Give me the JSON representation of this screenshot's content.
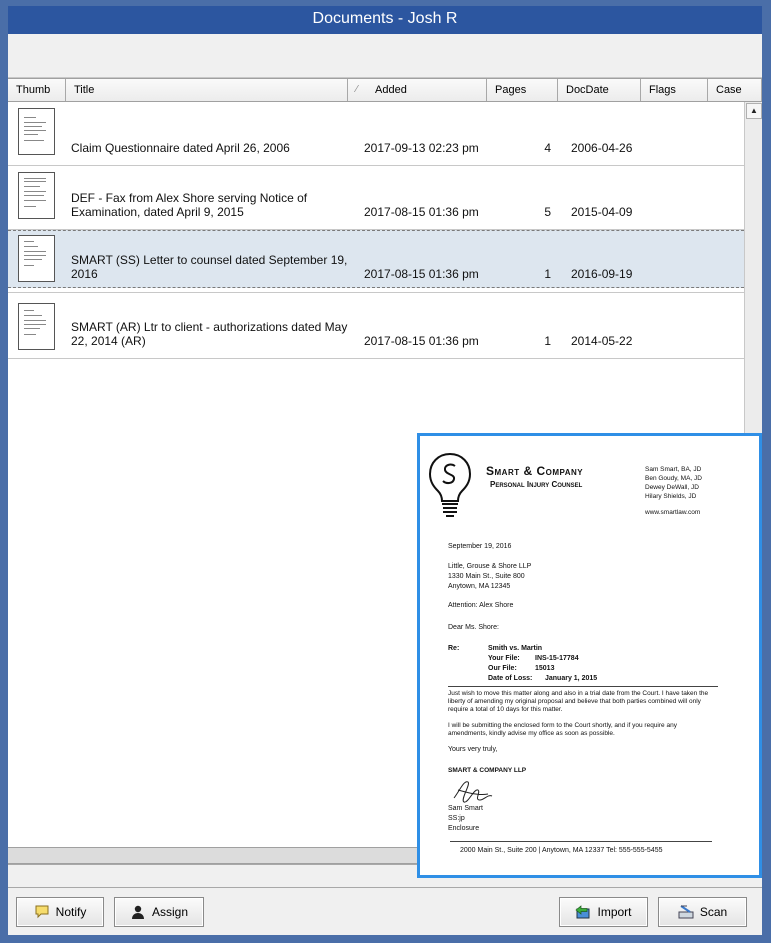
{
  "window": {
    "title": "Documents - Josh R"
  },
  "columns": {
    "thumb": "Thumb",
    "title": "Title",
    "sort_indicator": "⁄",
    "added": "Added",
    "pages": "Pages",
    "docdate": "DocDate",
    "flags": "Flags",
    "case": "Case"
  },
  "rows": [
    {
      "title": "Claim Questionnaire dated April 26, 2006",
      "added": "2017-09-13 02:23 pm",
      "pages": "4",
      "docdate": "2006-04-26",
      "flags": "",
      "case": ""
    },
    {
      "title": "DEF - Fax from Alex Shore serving Notice of Examination, dated April 9, 2015",
      "added": "2017-08-15 01:36 pm",
      "pages": "5",
      "docdate": "2015-04-09",
      "flags": "",
      "case": ""
    },
    {
      "title": "SMART (SS) Letter to counsel dated September 19, 2016",
      "added": "2017-08-15 01:36 pm",
      "pages": "1",
      "docdate": "2016-09-19",
      "flags": "",
      "case": "",
      "selected": true
    },
    {
      "title": "SMART (AR) Ltr to client - authorizations dated May 22, 2014 (AR)",
      "added": "2017-08-15 01:36 pm",
      "pages": "1",
      "docdate": "2014-05-22",
      "flags": "",
      "case": ""
    }
  ],
  "buttons": {
    "notify": "Notify",
    "assign": "Assign",
    "import": "Import",
    "scan": "Scan"
  },
  "icons": {
    "notify": "speech-bubble-icon",
    "assign": "person-icon",
    "import": "import-icon",
    "scan": "scanner-icon",
    "scroll_up": "arrow-up-icon"
  },
  "preview": {
    "firm_name": "Smart & Company",
    "firm_subtitle": "Personal Injury Counsel",
    "partners": [
      "Sam Smart, BA, JD",
      "Ben Goudy, MA, JD",
      "Dewey DeWall, JD",
      "Hilary Shields, JD"
    ],
    "website": "www.smartlaw.com",
    "date": "September 19, 2016",
    "recipient": [
      "Little, Grouse & Shore LLP",
      "1330 Main St., Suite 800",
      "Anytown, MA 12345"
    ],
    "attention": "Attention: Alex Shore",
    "salutation": "Dear Ms. Shore:",
    "re_label": "Re:",
    "re_case": "Smith vs. Martin",
    "your_file_label": "Your File:",
    "your_file": "INS-15-17784",
    "our_file_label": "Our File:",
    "our_file": "15013",
    "dol_label": "Date of Loss:",
    "dol": "January 1, 2015",
    "para1": "Just wish to move this matter along and also in a trial date from the Court. I have taken the liberty of amending my original proposal and believe that both parties combined will only require a total of 10 days for this matter.",
    "para2": "I will be submitting the enclosed form to the Court shortly, and if you require any amendments, kindly advise my office as soon as possible.",
    "closing": "Yours very truly,",
    "firm_llp": "SMART & COMPANY LLP",
    "signer": "Sam Smart",
    "initials": "SS:jp",
    "enclosure": "Enclosure",
    "footer": "2000 Main St., Suite 200  |   Anytown, MA 12337  Tel: 555-555-5455"
  },
  "colors": {
    "titlebar": "#2c56a0",
    "frame": "#4a6ea8",
    "selected_row": "#dde6ef",
    "preview_border": "#2f8fe6"
  }
}
